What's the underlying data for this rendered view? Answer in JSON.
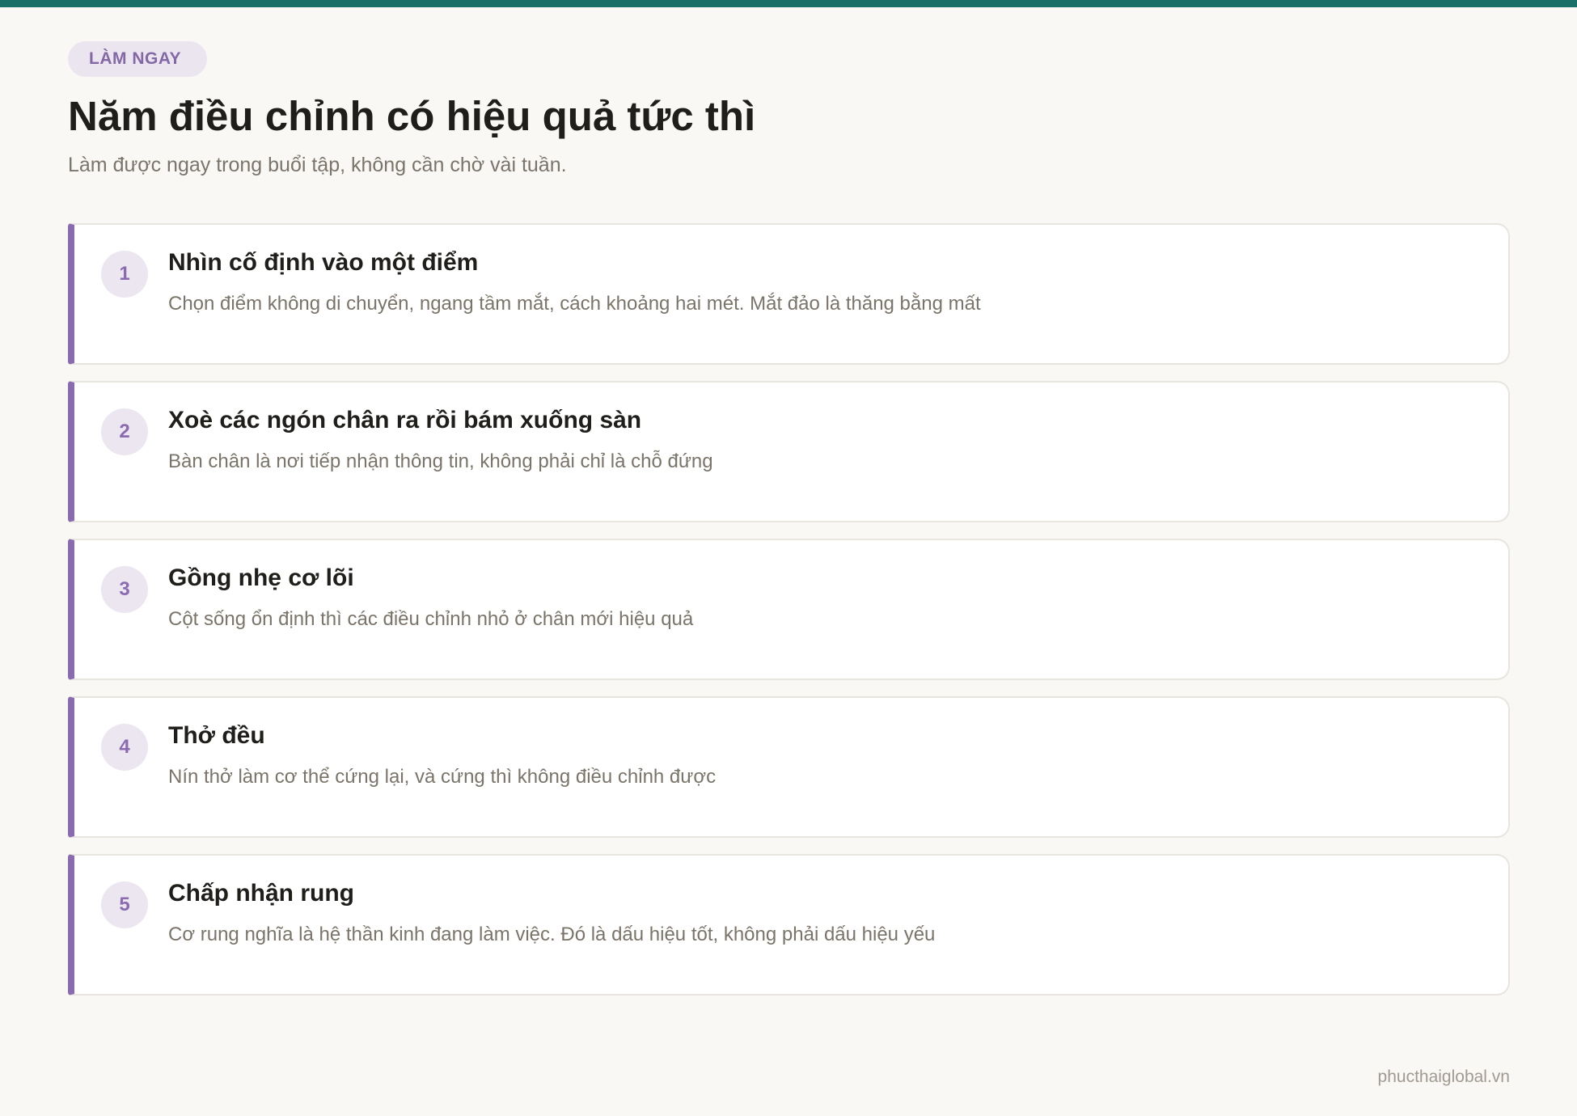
{
  "header": {
    "tag": "LÀM NGAY",
    "title": "Năm điều chỉnh có hiệu quả tức thì",
    "subtitle": "Làm được ngay trong buổi tập, không cần chờ vài tuần."
  },
  "items": [
    {
      "number": "1",
      "title": "Nhìn cố định vào một điểm",
      "description": "Chọn điểm không di chuyển, ngang tầm mắt, cách khoảng hai mét. Mắt đảo là thăng bằng mất"
    },
    {
      "number": "2",
      "title": "Xoè các ngón chân ra rồi bám xuống sàn",
      "description": "Bàn chân là nơi tiếp nhận thông tin, không phải chỉ là chỗ đứng"
    },
    {
      "number": "3",
      "title": "Gồng nhẹ cơ lõi",
      "description": "Cột sống ổn định thì các điều chỉnh nhỏ ở chân mới hiệu quả"
    },
    {
      "number": "4",
      "title": "Thở đều",
      "description": "Nín thở làm cơ thể cứng lại, và cứng thì không điều chỉnh được"
    },
    {
      "number": "5",
      "title": "Chấp nhận rung",
      "description": "Cơ rung nghĩa là hệ thần kinh đang làm việc. Đó là dấu hiệu tốt, không phải dấu hiệu yếu"
    }
  ],
  "footer": {
    "site": "phucthaiglobal.vn"
  },
  "colors": {
    "top_bar": "#1a7068",
    "accent": "#8a6bb0",
    "background": "#f9f8f5"
  }
}
